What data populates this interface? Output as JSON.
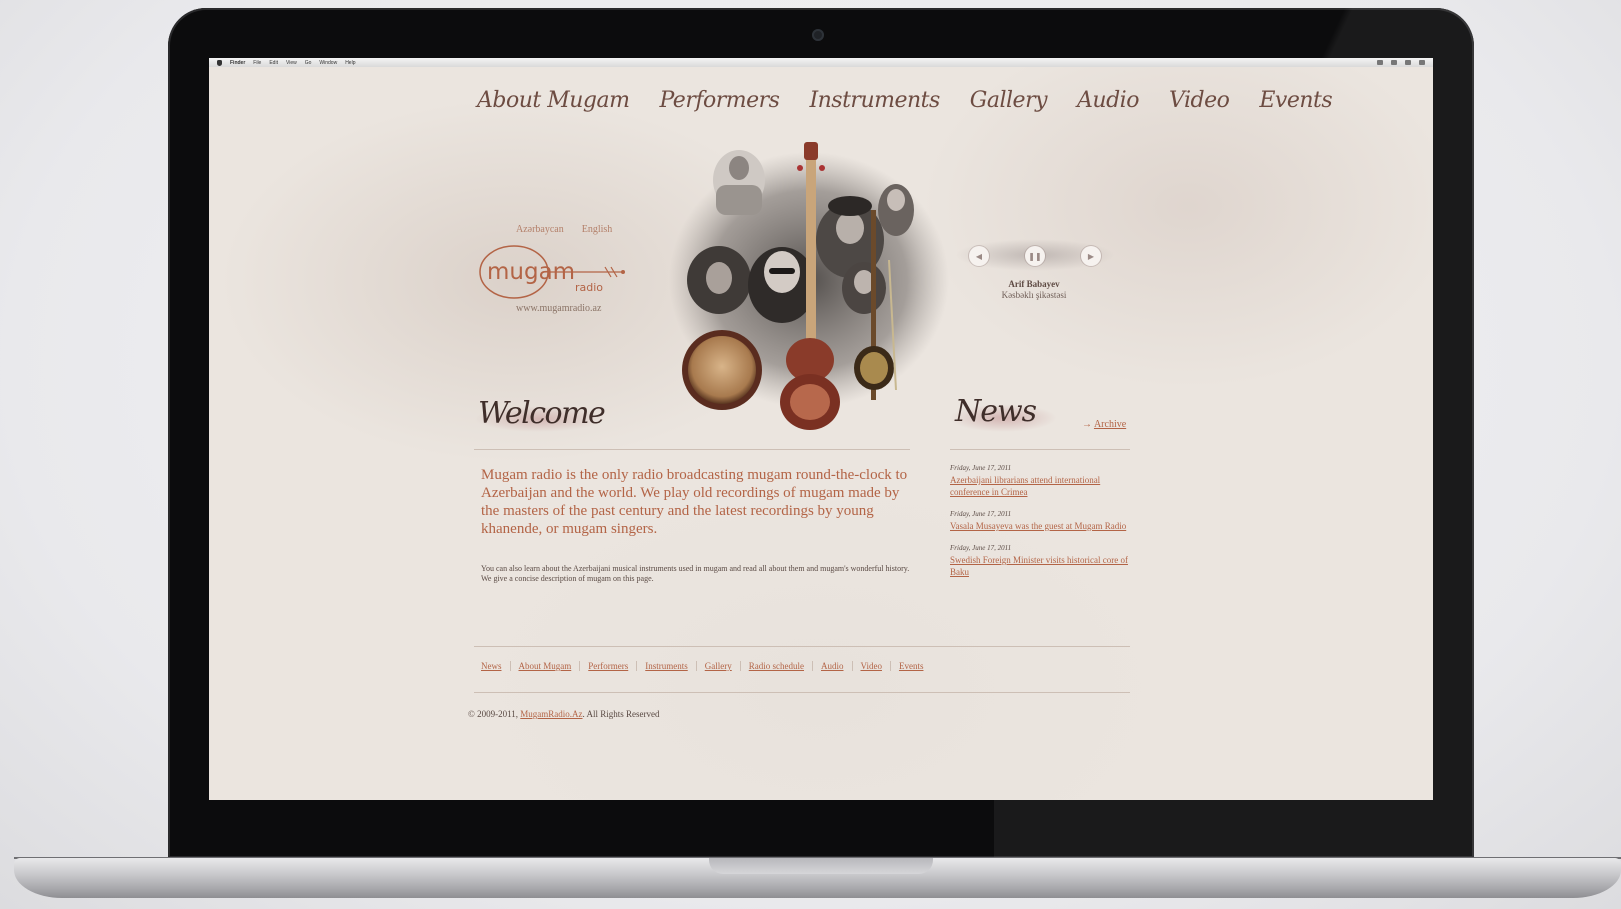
{
  "menubar": {
    "app": "Finder",
    "items": [
      "File",
      "Edit",
      "View",
      "Go",
      "Window",
      "Help"
    ]
  },
  "nav": [
    "About Mugam",
    "Performers",
    "Instruments",
    "Gallery",
    "Audio",
    "Video",
    "Events"
  ],
  "languages": [
    "Azərbaycan",
    "English"
  ],
  "logo": {
    "word": "mugam",
    "sub": "radio"
  },
  "site_url": "www.mugamradio.az",
  "player": {
    "artist": "Arif Babayev",
    "track": "Kəsbəklı şikəstəsi",
    "controls": [
      "prev-icon",
      "pause-icon",
      "next-icon"
    ]
  },
  "welcome": {
    "title": "Welcome",
    "lead": "Mugam radio is the only radio broadcasting mugam round-the-clock to Azerbaijan and the world. We play old recordings of mugam made by the masters of the past century and the latest recordings by young khanende, or mugam singers.",
    "body": "You can also learn about the Azerbaijani musical instruments used in mugam and read all about them and mugam's wonderful history. We give a concise description of mugam on this page."
  },
  "news": {
    "title": "News",
    "archive": "Archive",
    "items": [
      {
        "date": "Friday, June 17, 2011",
        "text": "Azerbaijani librarians attend international conference in Crimea"
      },
      {
        "date": "Friday, June 17, 2011",
        "text": "Vasala Musayeva was the guest at Mugam Radio"
      },
      {
        "date": "Friday, June 17, 2011",
        "text": "Swedish Foreign Minister visits historical core of Baku"
      }
    ]
  },
  "footer": {
    "links": [
      "News",
      "About Mugam",
      "Performers",
      "Instruments",
      "Gallery",
      "Radio schedule",
      "Audio",
      "Video",
      "Events"
    ],
    "copyright_prefix": "© 2009-2011,",
    "copyright_link": "MugamRadio.Az",
    "copyright_suffix": ". All Rights Reserved"
  },
  "colors": {
    "accent": "#b36446",
    "nav": "#6d4c42",
    "paper": "#ebe5df"
  }
}
